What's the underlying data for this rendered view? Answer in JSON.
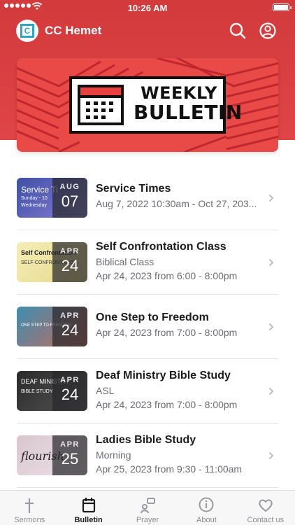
{
  "status": {
    "time": "10:26 AM"
  },
  "header": {
    "title": "CC Hemet",
    "logo_letter": "C"
  },
  "banner": {
    "line1": "WEEKLY",
    "line2": "BULLETIN"
  },
  "items": [
    {
      "title": "Service Times",
      "lines": [
        "Aug 7, 2022 10:30am - Oct 27, 203..."
      ],
      "month": "AUG",
      "day": "07",
      "thumb_text": "Service Ti",
      "thumb_sub": "Sunday - 10",
      "thumb_sub2": "Wednesday",
      "thumb_colors": [
        "#3f4fa5",
        "#8a7fd6"
      ]
    },
    {
      "title": "Self Confrontation Class",
      "lines": [
        "Biblical Class",
        "Apr 24, 2023 from 6:00 - 8:00pm"
      ],
      "month": "APR",
      "day": "24",
      "thumb_text": "Self Confrontation",
      "thumb_sub": "SELF-CONFRONTATION",
      "thumb_colors": [
        "#f4edb7",
        "#e6d88a"
      ]
    },
    {
      "title": "One Step to Freedom",
      "lines": [
        "Apr 24, 2023 from 7:00 - 8:00pm"
      ],
      "month": "APR",
      "day": "24",
      "thumb_text": "ONE STEP TO FREEDOM",
      "thumb_colors": [
        "#3e8db0",
        "#c96a5a"
      ]
    },
    {
      "title": "Deaf Ministry Bible Study",
      "lines": [
        "ASL",
        "Apr 24, 2023 from 7:00 - 8:00pm"
      ],
      "month": "APR",
      "day": "24",
      "thumb_text": "DEAF MINISTRY",
      "thumb_sub": "BIBLE STUDY",
      "thumb_colors": [
        "#2a2a2a",
        "#555555"
      ]
    },
    {
      "title": "Ladies Bible Study",
      "lines": [
        "Morning",
        "Apr 25, 2023 from 9:30 - 11:00am"
      ],
      "month": "APR",
      "day": "25",
      "thumb_text": "flourish",
      "thumb_colors": [
        "#d9c6cf",
        "#ece3e7"
      ]
    }
  ],
  "tabs": [
    {
      "label": "Sermons",
      "icon": "cross-icon",
      "active": false
    },
    {
      "label": "Bulletin",
      "icon": "bulletin-icon",
      "active": true
    },
    {
      "label": "Prayer",
      "icon": "prayer-icon",
      "active": false
    },
    {
      "label": "About",
      "icon": "info-icon",
      "active": false
    },
    {
      "label": "Contact us",
      "icon": "heart-icon",
      "active": false
    }
  ],
  "colors": {
    "brand": "#e04446",
    "logo": "#2aa6c7"
  }
}
